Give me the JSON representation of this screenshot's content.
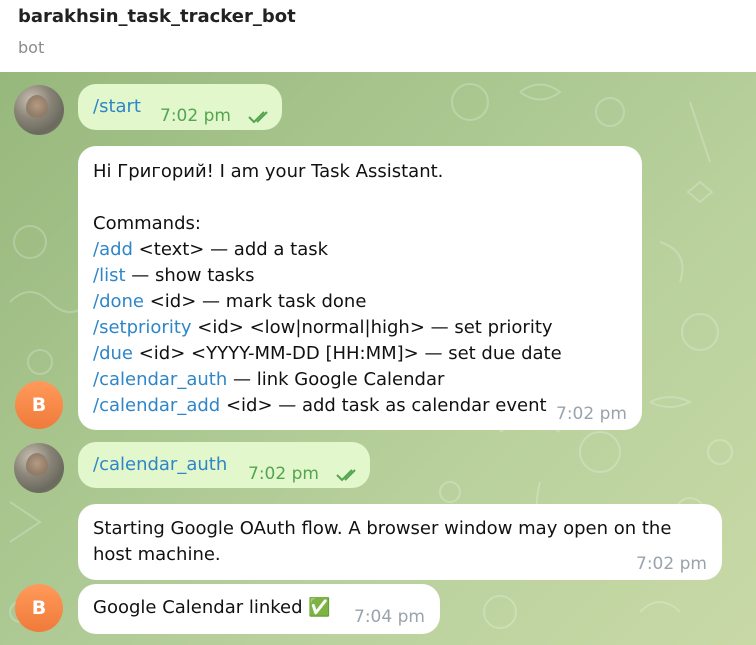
{
  "header": {
    "title": "barakhsin_task_tracker_bot",
    "subtitle": "bot"
  },
  "bot_avatar_letter": "B",
  "messages": [
    {
      "direction": "outgoing",
      "command": "/start",
      "time": "7:02 pm"
    },
    {
      "direction": "incoming",
      "greeting": "Hi Григорий! I am your Task Assistant.",
      "commands_header": "Commands:",
      "commands": [
        {
          "cmd": "/add",
          "desc": " <text> — add a task"
        },
        {
          "cmd": "/list",
          "desc": " — show tasks"
        },
        {
          "cmd": "/done",
          "desc": " <id> — mark task done"
        },
        {
          "cmd": "/setpriority",
          "desc": " <id> <low|normal|high> — set priority"
        },
        {
          "cmd": "/due",
          "desc": " <id> <YYYY-MM-DD [HH:MM]> — set due date"
        },
        {
          "cmd": "/calendar_auth",
          "desc": " — link Google Calendar"
        },
        {
          "cmd": "/calendar_add",
          "desc": " <id> — add task as calendar event"
        }
      ],
      "time": "7:02 pm"
    },
    {
      "direction": "outgoing",
      "command": "/calendar_auth",
      "time": "7:02 pm"
    },
    {
      "direction": "incoming",
      "text_line1": "Starting Google OAuth flow. A browser window may open on the",
      "text_line2": "host machine.",
      "time": "7:02 pm"
    },
    {
      "direction": "incoming",
      "text": "Google Calendar linked ✅",
      "time": "7:04 pm"
    }
  ],
  "colors": {
    "outgoing_bubble": "#e2f7cb",
    "incoming_bubble": "#ffffff",
    "command_link": "#2e86c8",
    "outgoing_time": "#53a550",
    "bot_avatar": "#f07a3a"
  }
}
